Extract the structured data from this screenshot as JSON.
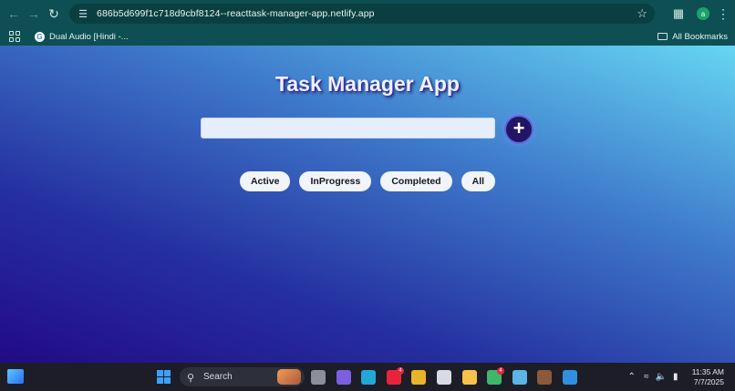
{
  "browser": {
    "url": "686b5d699f1c718d9cbf8124--reacttask-manager-app.netlify.app",
    "bookmarks": [
      {
        "label": "Dual Audio [Hindi -..."
      }
    ],
    "all_bookmarks_label": "All Bookmarks",
    "profile_initial": "a"
  },
  "app": {
    "title": "Task Manager App",
    "input": {
      "value": "",
      "placeholder": ""
    },
    "add_label": "+",
    "filters": [
      {
        "label": "Active"
      },
      {
        "label": "InProgress"
      },
      {
        "label": "Completed"
      },
      {
        "label": "All"
      }
    ]
  },
  "taskbar": {
    "search_label": "Search",
    "time": "11:35 AM",
    "date": "7/7/2025",
    "apps": [
      {
        "icon": "file-explorer-shortcut-icon",
        "color": "#8c8f99"
      },
      {
        "icon": "teams-icon",
        "color": "#7b5fe0"
      },
      {
        "icon": "edge-icon",
        "color": "#23a7d9"
      },
      {
        "icon": "youtube-icon",
        "color": "#e8243d",
        "badge": "4"
      },
      {
        "icon": "chrome-icon",
        "color": "#e8b42a"
      },
      {
        "icon": "document-icon",
        "color": "#d8dbe4"
      },
      {
        "icon": "folder-icon",
        "color": "#f5c14a"
      },
      {
        "icon": "chrome-active-icon",
        "color": "#3fb76b",
        "badge": "4"
      },
      {
        "icon": "notepad-icon",
        "color": "#5bb3e6"
      },
      {
        "icon": "game-icon",
        "color": "#8a5a3a"
      },
      {
        "icon": "vscode-icon",
        "color": "#2f8fe0"
      }
    ]
  }
}
